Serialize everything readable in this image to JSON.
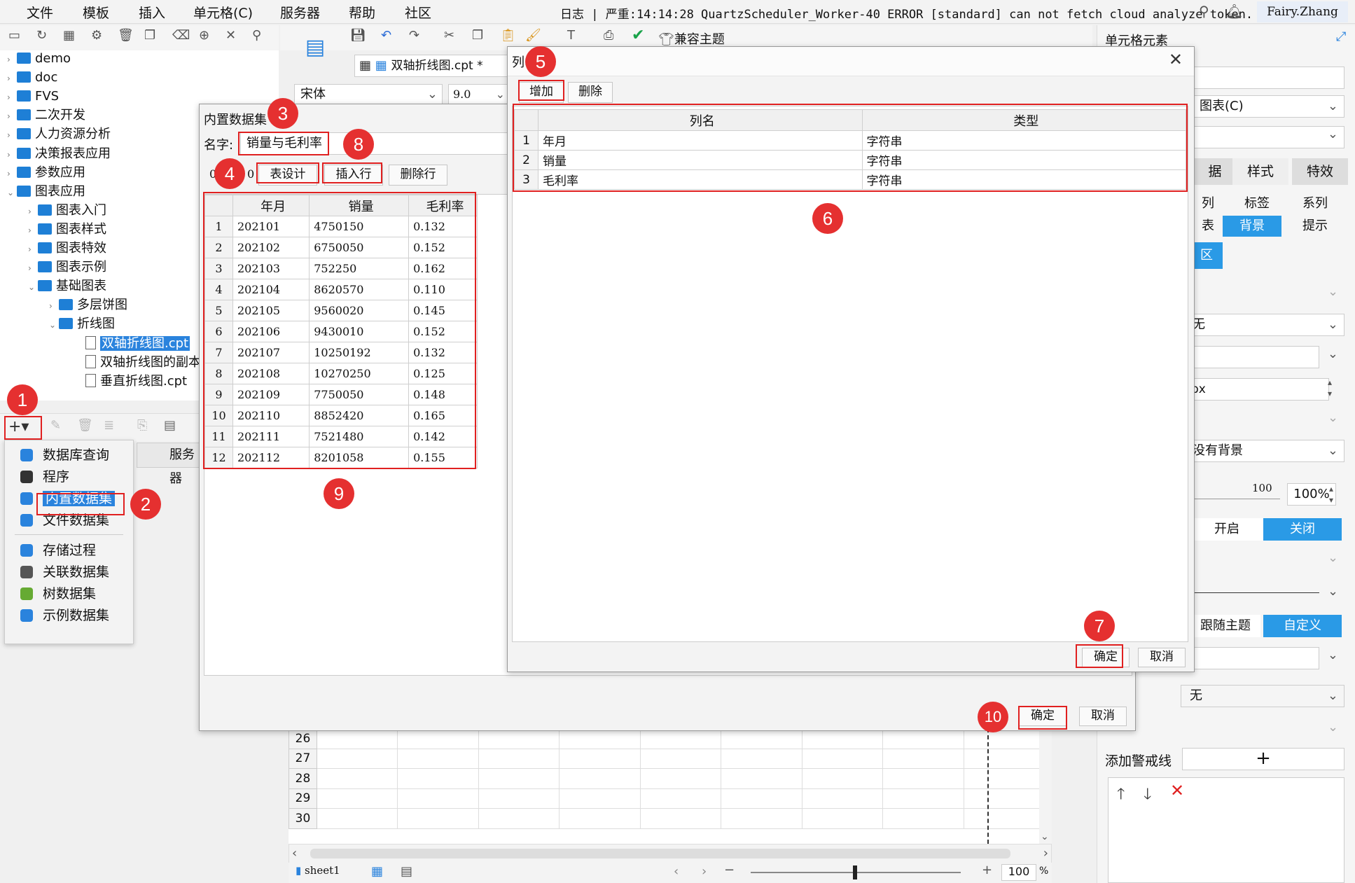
{
  "menu": [
    "文件",
    "模板",
    "插入",
    "单元格(C)",
    "服务器",
    "帮助",
    "社区"
  ],
  "log": "日志 | 严重:14:14:28 QuartzScheduler_Worker-40 ERROR [standard] can not fetch cloud analyze token.",
  "user": "Fairy.Zhang",
  "toolbar": {
    "compat_theme": "兼容主题",
    "file_tab": "双轴折线图.cpt *",
    "font": "宋体",
    "size": "9.0"
  },
  "tree": {
    "items": [
      "demo",
      "doc",
      "FVS",
      "二次开发",
      "人力资源分析",
      "决策报表应用",
      "参数应用",
      "图表应用",
      "图表入门",
      "图表样式",
      "图表特效",
      "图表示例",
      "基础图表",
      "多层饼图",
      "折线图",
      "双轴折线图.cpt",
      "双轴折线图的副本",
      "垂直折线图.cpt"
    ]
  },
  "popup": {
    "items": [
      "数据库查询",
      "程序",
      "内置数据集",
      "文件数据集",
      "存储过程",
      "关联数据集",
      "树数据集",
      "示例数据集"
    ],
    "server_label": "服务器"
  },
  "builtin": {
    "title": "内置数据集",
    "name_label": "名字:",
    "name_value": "销量与毛利率",
    "btn_design": "表设计",
    "btn_insert": "插入行",
    "btn_delete": "删除行",
    "ok": "确定",
    "cancel": "取消",
    "headers": [
      "年月",
      "销量",
      "毛利率"
    ],
    "rows": [
      [
        "1",
        "202101",
        "4750150",
        "0.132"
      ],
      [
        "2",
        "202102",
        "6750050",
        "0.152"
      ],
      [
        "3",
        "202103",
        "752250",
        "0.162"
      ],
      [
        "4",
        "202104",
        "8620570",
        "0.110"
      ],
      [
        "5",
        "202105",
        "9560020",
        "0.145"
      ],
      [
        "6",
        "202106",
        "9430010",
        "0.152"
      ],
      [
        "7",
        "202107",
        "10250192",
        "0.132"
      ],
      [
        "8",
        "202108",
        "10270250",
        "0.125"
      ],
      [
        "9",
        "202109",
        "7750050",
        "0.148"
      ],
      [
        "10",
        "202110",
        "8852420",
        "0.165"
      ],
      [
        "11",
        "202111",
        "7521480",
        "0.142"
      ],
      [
        "12",
        "202112",
        "8201058",
        "0.155"
      ]
    ]
  },
  "coldialog": {
    "title": "列",
    "btn_add": "增加",
    "btn_delete": "删除",
    "headers": [
      "列名",
      "类型"
    ],
    "rows": [
      [
        "1",
        "年月",
        "字符串"
      ],
      [
        "2",
        "销量",
        "字符串"
      ],
      [
        "3",
        "毛利率",
        "字符串"
      ]
    ],
    "ok": "确定",
    "cancel": "取消"
  },
  "badges": [
    "1",
    "2",
    "3",
    "4",
    "5",
    "6",
    "7",
    "8",
    "9",
    "10"
  ],
  "right_panel": {
    "title": "单元格元素",
    "chart_label": "图表(C)",
    "tabs": [
      "据",
      "样式",
      "特效"
    ],
    "subtabs": [
      "列",
      "标签",
      "系列",
      "表",
      "背景",
      "提示"
    ],
    "area": "区",
    "none1": "无",
    "px": "px",
    "nobg": "没有背景",
    "slider_val": "100",
    "percent": "100%",
    "on": "开启",
    "off": "关闭",
    "follow": "跟随主题",
    "custom": "自定义",
    "none2": "无",
    "warn_label": "添加警戒线"
  },
  "sheet": {
    "rows": [
      "26",
      "27",
      "28",
      "29",
      "30"
    ],
    "tab": "sheet1",
    "zoom": "100"
  }
}
